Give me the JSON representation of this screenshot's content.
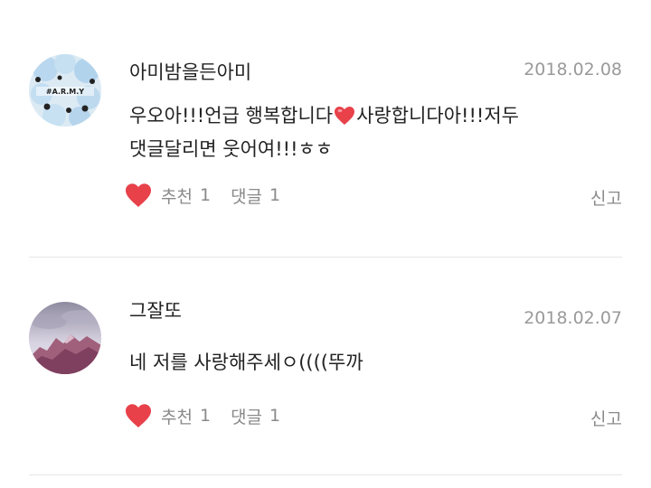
{
  "comments": [
    {
      "username": "아미밤을든아미",
      "date": "2018.02.08",
      "text_line1_a": "우오아!!!언급 행복합니다",
      "text_line1_b": "사랑합니다아!!!저두",
      "text_line2": "댓글달리면 웃어여!!!ㅎㅎ",
      "avatar_text": "#A.R.M.Y",
      "like_label": "추천",
      "like_count": "1",
      "reply_label": "댓글",
      "reply_count": "1",
      "report_label": "신고"
    },
    {
      "username": "그잘또",
      "date": "2018.02.07",
      "text_line1": "네 저를 사랑해주세ㅇ((((뚜까",
      "like_label": "추천",
      "like_count": "1",
      "reply_label": "댓글",
      "reply_count": "1",
      "report_label": "신고"
    }
  ],
  "colors": {
    "heart": "#e8414a",
    "muted": "#8a8a8a",
    "date": "#9a9a9a",
    "divider": "#e6e6e6"
  },
  "icons": {
    "like": "heart-icon",
    "inline_emoji": "red-heart-emoji-icon"
  }
}
